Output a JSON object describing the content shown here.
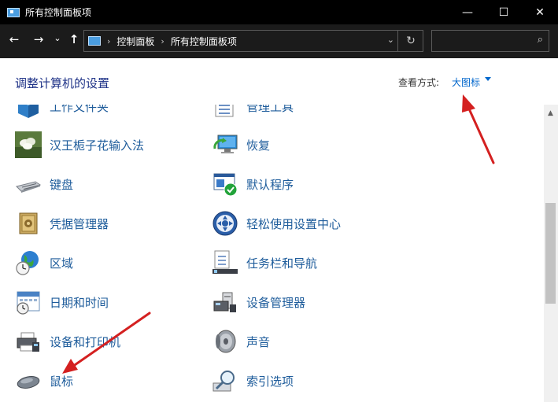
{
  "window": {
    "title": "所有控制面板项",
    "minimize": "—",
    "maximize": "☐",
    "close": "✕"
  },
  "nav": {
    "back": "←",
    "forward": "→",
    "recent": "⌄",
    "up": "↑",
    "breadcrumb": [
      "控制面板",
      "所有控制面板项"
    ],
    "separator": "›",
    "dropdown": "⌄",
    "refresh": "↻",
    "search_icon": "⌕"
  },
  "header": {
    "title": "调整计算机的设置",
    "view_by_label": "查看方式:",
    "view_by_value": "大图标"
  },
  "items_left": [
    {
      "label": "工作文件夹",
      "icon": "work-folders-icon"
    },
    {
      "label": "汉王栀子花输入法",
      "icon": "gardenia-flower-icon"
    },
    {
      "label": "键盘",
      "icon": "keyboard-icon"
    },
    {
      "label": "凭据管理器",
      "icon": "credential-safe-icon"
    },
    {
      "label": "区域",
      "icon": "globe-clock-icon"
    },
    {
      "label": "日期和时间",
      "icon": "calendar-clock-icon"
    },
    {
      "label": "设备和打印机",
      "icon": "printer-icon"
    },
    {
      "label": "鼠标",
      "icon": "mouse-icon"
    }
  ],
  "items_right": [
    {
      "label": "管理工具",
      "icon": "admin-tools-icon"
    },
    {
      "label": "恢复",
      "icon": "recovery-icon"
    },
    {
      "label": "默认程序",
      "icon": "default-programs-icon"
    },
    {
      "label": "轻松使用设置中心",
      "icon": "ease-of-access-icon"
    },
    {
      "label": "任务栏和导航",
      "icon": "taskbar-icon"
    },
    {
      "label": "设备管理器",
      "icon": "device-manager-icon"
    },
    {
      "label": "声音",
      "icon": "speaker-icon"
    },
    {
      "label": "索引选项",
      "icon": "indexing-icon"
    }
  ],
  "colors": {
    "link": "#1e5c9b",
    "heading": "#1e3287",
    "accent": "#0066cc",
    "annotation_arrow": "#d42020"
  }
}
